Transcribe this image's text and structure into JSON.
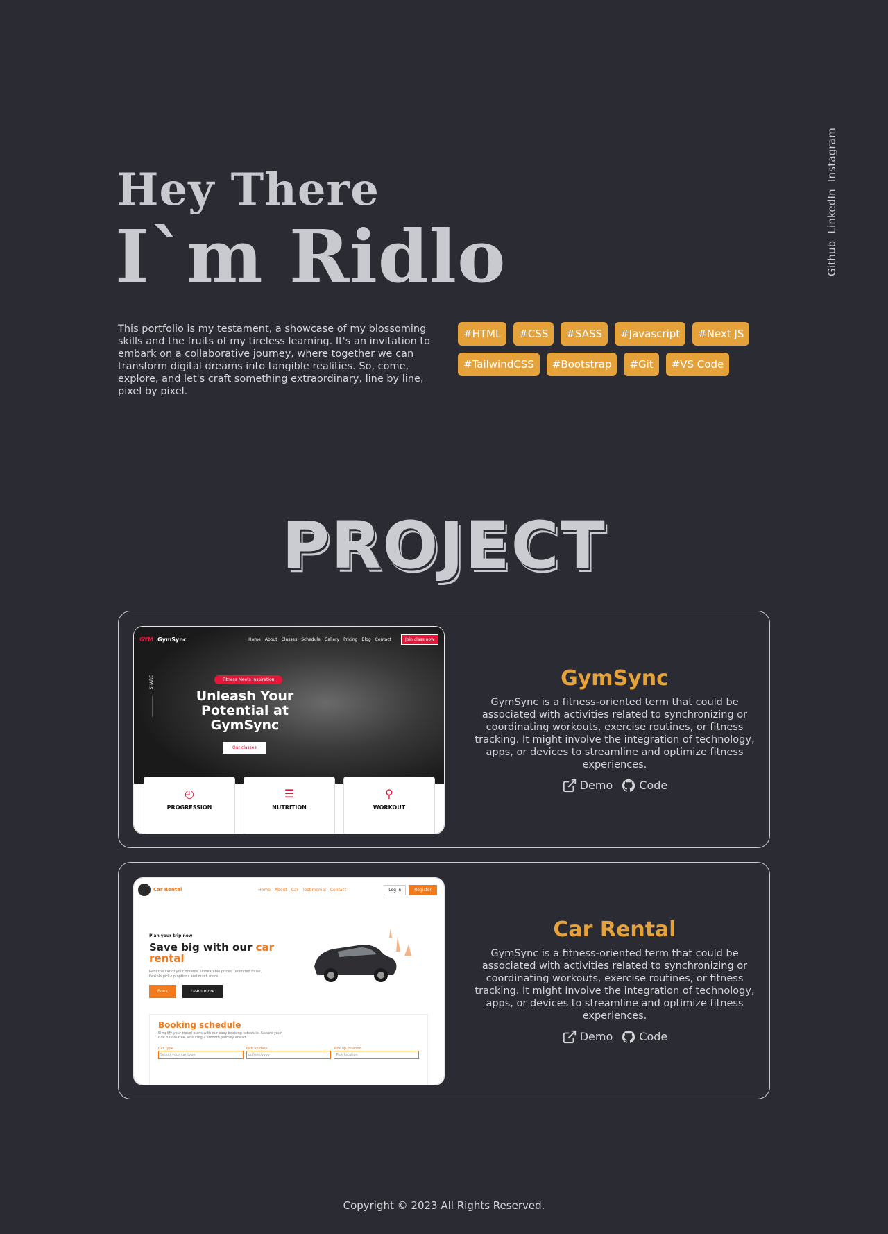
{
  "social": [
    "Github",
    "LinkedIn",
    "Instagram"
  ],
  "hero": {
    "line1": "Hey There",
    "line2": "I`m Ridlo"
  },
  "intro": "This portfolio is my testament, a showcase of my blossoming skills and the fruits of my tireless learning. It's an invitation to embark on a collaborative journey, where together we can transform digital dreams into tangible realities. So, come, explore, and let's craft something extraordinary, line by line, pixel by pixel.",
  "tags": [
    "#HTML",
    "#CSS",
    "#SASS",
    "#Javascript",
    "#Next JS",
    "#TailwindCSS",
    "#Bootstrap",
    "#Git",
    "#VS Code"
  ],
  "section_title": "PROJECT",
  "projects": [
    {
      "title": "GymSync",
      "description": "GymSync is a fitness-oriented term that could be associated with activities related to synchronizing or coordinating workouts, exercise routines, or fitness tracking. It might involve the integration of technology, apps, or devices to streamline and optimize fitness experiences.",
      "demo_label": "Demo",
      "code_label": "Code",
      "preview": {
        "logo": "GYM",
        "brand": "GymSync",
        "nav": [
          "Home",
          "About",
          "Classes",
          "Schedule",
          "Gallery",
          "Pricing",
          "Blog",
          "Contact"
        ],
        "join": "Join class now",
        "pill": "Fitness Meets Inspiration",
        "headline": "Unleash Your Potential at GymSync",
        "button": "Our classes",
        "share": "SHARE",
        "cards": [
          "PROGRESSION",
          "NUTRITION",
          "WORKOUT"
        ]
      }
    },
    {
      "title": "Car Rental",
      "description": "GymSync is a fitness-oriented term that could be associated with activities related to synchronizing or coordinating workouts, exercise routines, or fitness tracking. It might involve the integration of technology, apps, or devices to streamline and optimize fitness experiences.",
      "demo_label": "Demo",
      "code_label": "Code",
      "preview": {
        "brand": "Car Rental",
        "nav": [
          "Home",
          "About",
          "Car",
          "Testimonial",
          "Contact"
        ],
        "login": "Log in",
        "register": "Register",
        "small": "Plan your trip now",
        "headline_a": "Save big with our ",
        "headline_b": "car rental",
        "paragraph": "Rent the car of your dreams. Unbeatable prices, unlimited miles, flexible pick-up options and much more.",
        "book": "Book",
        "learn": "Learn more",
        "booking_title": "Booking schedule",
        "booking_text": "Simplify your travel plans with our easy booking schedule. Secure your ride hassle-free, ensuring a smooth journey ahead.",
        "fields": [
          {
            "label": "Car Type",
            "placeholder": "Select your car type"
          },
          {
            "label": "Pick up date",
            "placeholder": "dd/mm/yyyy"
          },
          {
            "label": "Pick up location",
            "placeholder": "Pick location"
          }
        ]
      }
    }
  ],
  "footer": "Copyright © 2023 All Rights Reserved.",
  "colors": {
    "background": "#2b2b33",
    "accent": "#e5a23b",
    "text": "#c9cacf"
  }
}
